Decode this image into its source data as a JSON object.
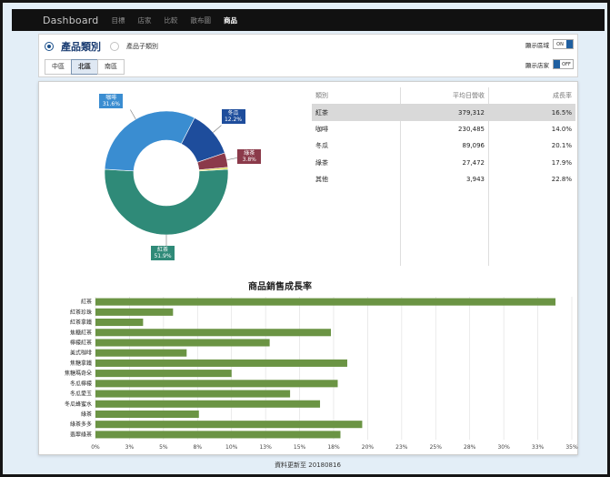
{
  "nav": {
    "brand": "Dashboard",
    "items": [
      "目標",
      "店家",
      "比較",
      "散布圖",
      "商品"
    ],
    "active_index": 4
  },
  "filters": {
    "category_label": "產品類別",
    "subcategory_label": "產品子類別",
    "regions": [
      "中區",
      "北區",
      "南區"
    ],
    "active_region_index": 1,
    "show_region": {
      "label": "顯示區域",
      "state": "ON"
    },
    "show_store": {
      "label": "顯示店家",
      "state": "OFF"
    }
  },
  "colors": {
    "coffee": "#3a8dd1",
    "winter_melon": "#1e4d9c",
    "green_tea": "#8b3a4a",
    "black_tea": "#2f8a78",
    "other": "#d6d54a",
    "bar": "#6b9444"
  },
  "donut": {
    "slices": [
      {
        "name": "紅茶",
        "pct": 51.9,
        "display": "51.9%",
        "color_key": "black_tea"
      },
      {
        "name": "咖啡",
        "pct": 31.6,
        "display": "31.6%",
        "color_key": "coffee"
      },
      {
        "name": "冬瓜",
        "pct": 12.2,
        "display": "12.2%",
        "color_key": "winter_melon"
      },
      {
        "name": "綠茶",
        "pct": 3.8,
        "display": "3.8%",
        "color_key": "green_tea"
      },
      {
        "name": "其他",
        "pct": 0.5,
        "display": "",
        "color_key": "other"
      }
    ]
  },
  "table": {
    "headers": [
      "類別",
      "平均日營收",
      "成長率"
    ],
    "rows": [
      [
        "紅茶",
        "379,312",
        "16.5%"
      ],
      [
        "咖啡",
        "230,485",
        "14.0%"
      ],
      [
        "冬瓜",
        "89,096",
        "20.1%"
      ],
      [
        "綠茶",
        "27,472",
        "17.9%"
      ],
      [
        "其他",
        "3,943",
        "22.8%"
      ]
    ],
    "selected_index": 0
  },
  "chart_data": {
    "type": "bar",
    "orientation": "horizontal",
    "title": "商品銷售成長率",
    "categories": [
      "紅茶",
      "紅茶珍珠",
      "紅茶拿鐵",
      "焦糖紅茶",
      "檸檬紅茶",
      "美式咖啡",
      "焦糖拿鐵",
      "焦糖瑪奇朵",
      "冬瓜檸檬",
      "冬瓜愛玉",
      "冬瓜蜂蜜水",
      "綠茶",
      "綠茶多多",
      "翡翠綠茶"
    ],
    "values": [
      33.8,
      5.7,
      3.5,
      17.3,
      12.8,
      6.7,
      18.5,
      10.0,
      17.8,
      14.3,
      16.5,
      7.6,
      19.6,
      18.0
    ],
    "xlim": [
      0,
      35
    ],
    "xticks": [
      "0%",
      "3%",
      "5%",
      "8%",
      "10%",
      "13%",
      "15%",
      "18%",
      "20%",
      "23%",
      "25%",
      "28%",
      "30%",
      "33%",
      "35%"
    ],
    "grid": true
  },
  "footer": "資料更新至 20180816"
}
